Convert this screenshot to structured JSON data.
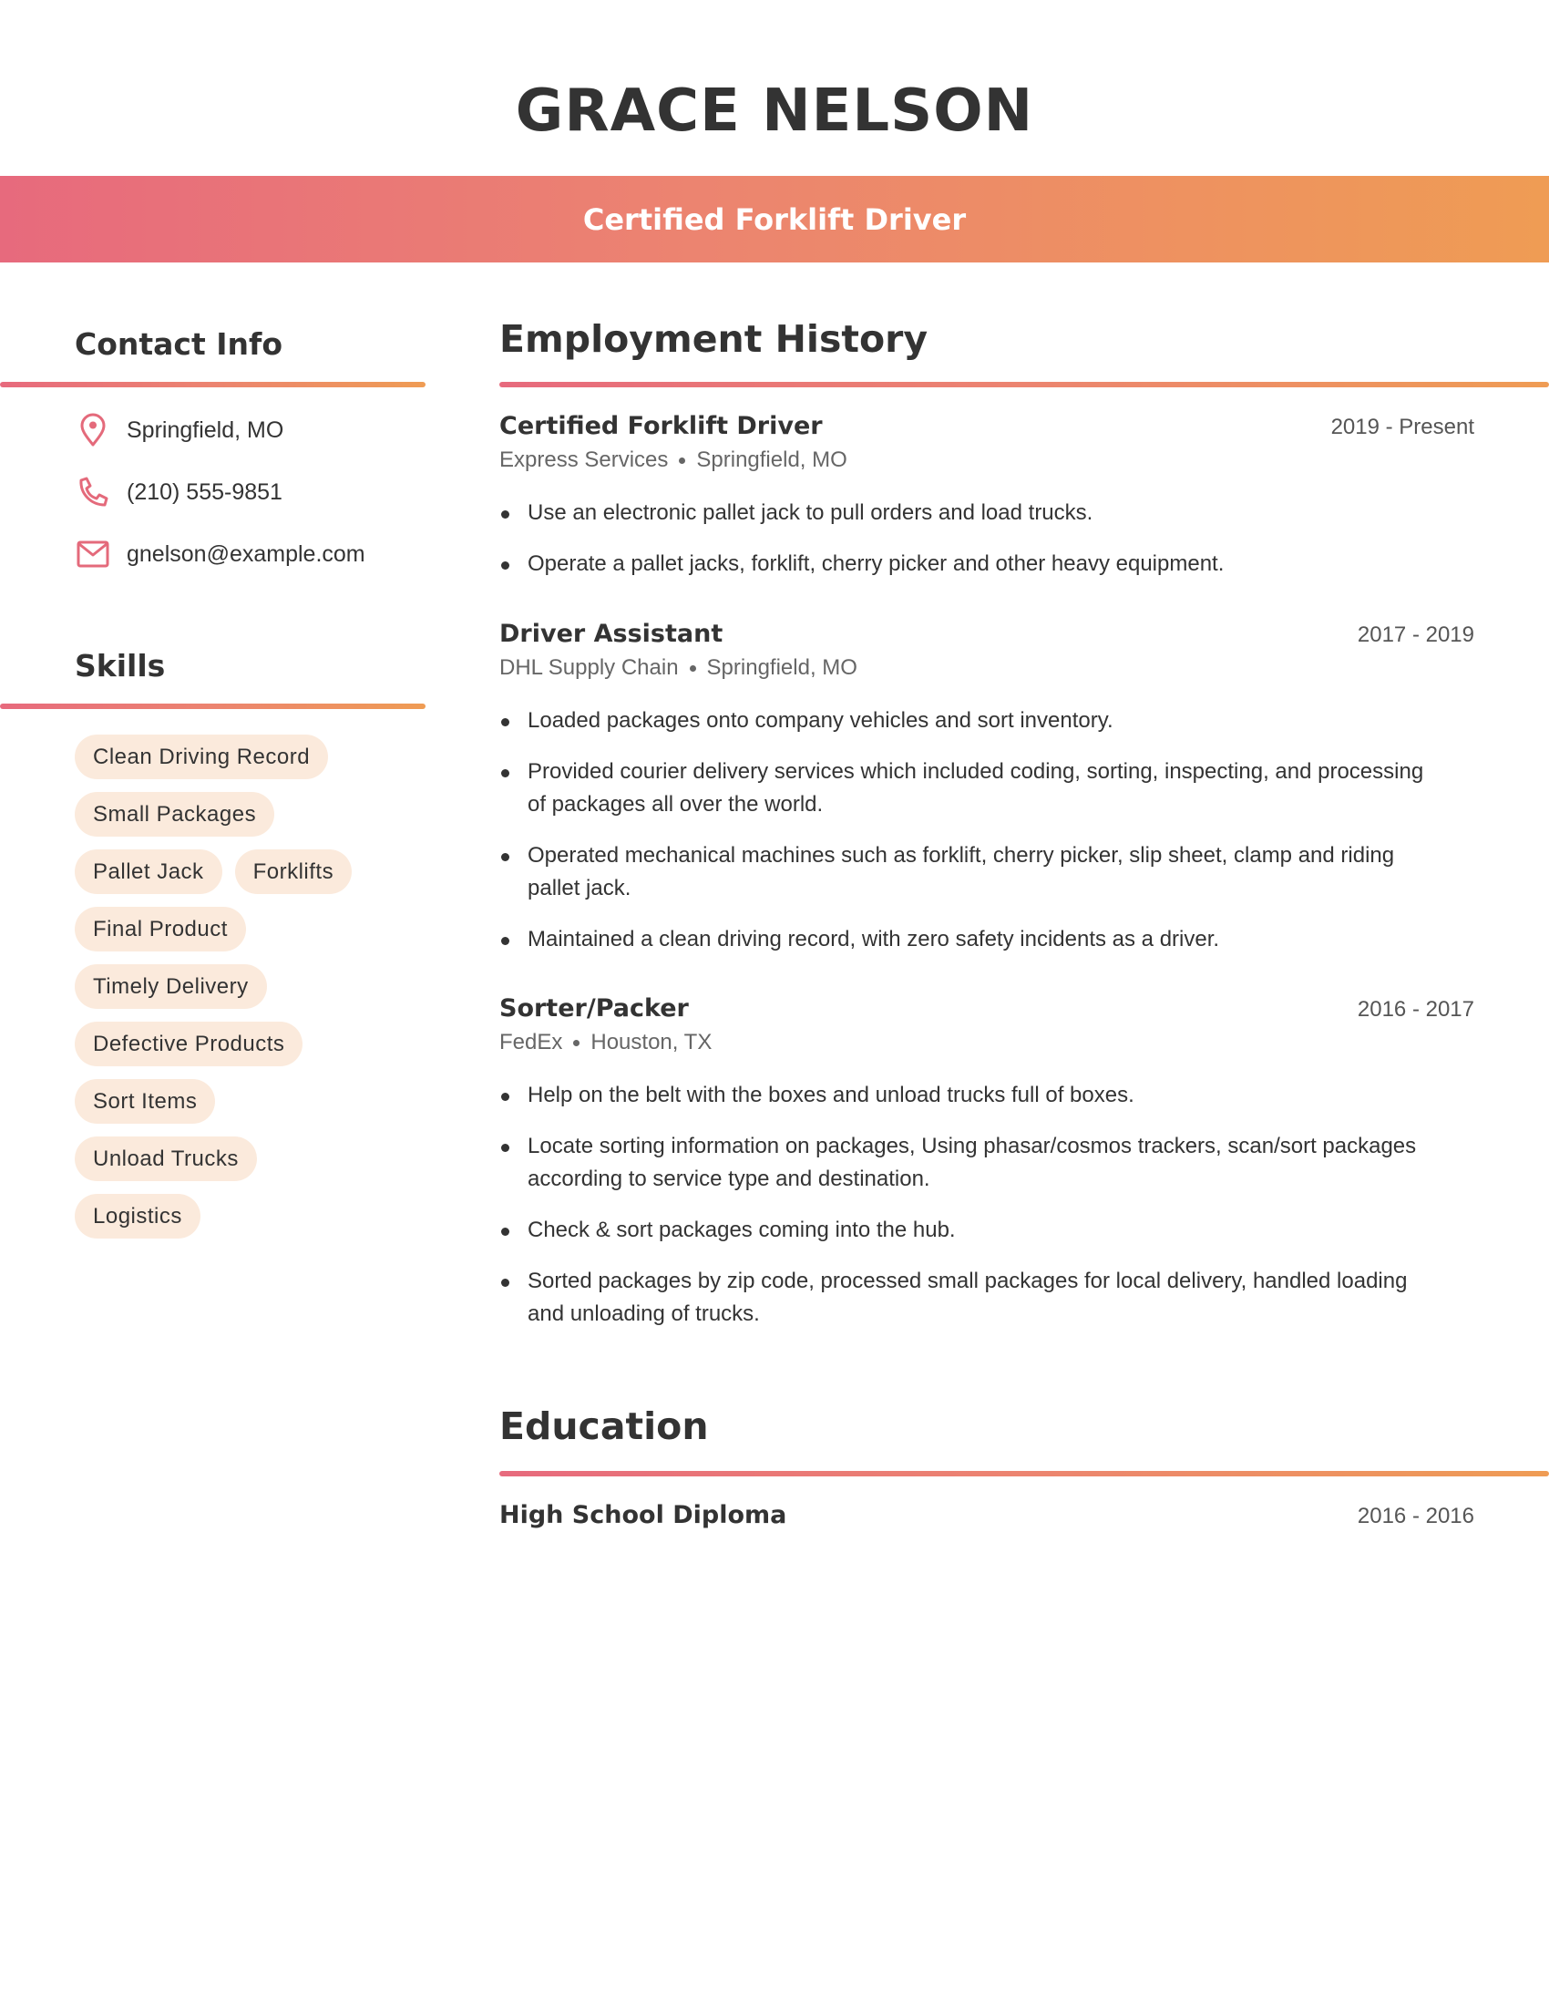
{
  "header": {
    "name": "GRACE NELSON",
    "title": "Certified Forklift Driver"
  },
  "colors": {
    "gradient_start": "#E76A7D",
    "gradient_end": "#EF9C54",
    "pill_bg": "#FBEADC",
    "icon": "#E46A7B",
    "text": "#333333"
  },
  "contact": {
    "heading": "Contact Info",
    "items": [
      {
        "icon": "map-pin-icon",
        "value": "Springfield, MO"
      },
      {
        "icon": "phone-icon",
        "value": "(210) 555-9851"
      },
      {
        "icon": "mail-icon",
        "value": "gnelson@example.com"
      }
    ]
  },
  "skills": {
    "heading": "Skills",
    "items": [
      "Clean Driving Record",
      "Small Packages",
      "Pallet Jack",
      "Forklifts",
      "Final Product",
      "Timely Delivery",
      "Defective Products",
      "Sort Items",
      "Unload Trucks",
      "Logistics"
    ]
  },
  "employment": {
    "heading": "Employment History",
    "jobs": [
      {
        "title": "Certified Forklift Driver",
        "dates": "2019 - Present",
        "company": "Express Services",
        "location": "Springfield, MO",
        "bullets": [
          "Use an electronic pallet jack to pull orders and load trucks.",
          "Operate a pallet jacks, forklift, cherry picker and other heavy equipment."
        ]
      },
      {
        "title": "Driver Assistant",
        "dates": "2017 - 2019",
        "company": "DHL Supply Chain",
        "location": "Springfield, MO",
        "bullets": [
          "Loaded packages onto company vehicles and sort inventory.",
          "Provided courier delivery services which included coding, sorting, inspecting, and processing of packages all over the world.",
          "Operated mechanical machines such as forklift, cherry picker, slip sheet, clamp and riding pallet jack.",
          "Maintained a clean driving record, with zero safety incidents as a driver."
        ]
      },
      {
        "title": "Sorter/Packer",
        "dates": "2016 - 2017",
        "company": "FedEx",
        "location": "Houston, TX",
        "bullets": [
          "Help on the belt with the boxes and unload trucks full of boxes.",
          "Locate sorting information on packages, Using phasar/cosmos trackers, scan/sort packages according to service type and destination.",
          "Check & sort packages coming into the hub.",
          "Sorted packages by zip code, processed small packages for local delivery, handled loading and unloading of trucks."
        ]
      }
    ]
  },
  "education": {
    "heading": "Education",
    "items": [
      {
        "title": "High School Diploma",
        "dates": "2016 - 2016"
      }
    ]
  }
}
